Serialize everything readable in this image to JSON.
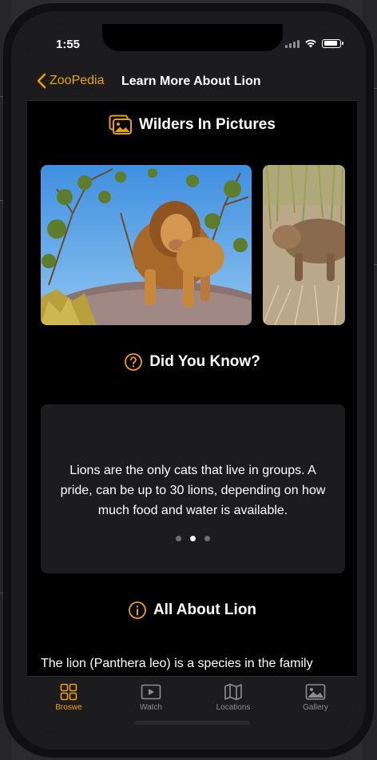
{
  "status_bar": {
    "time": "1:55",
    "battery_level_percent": 90
  },
  "nav": {
    "back_label": "ZooPedia",
    "title": "Learn More About Lion"
  },
  "gallery": {
    "heading": "Wilders In Pictures",
    "icon": "photos-icon",
    "photo_count_visible": 2
  },
  "did_you_know": {
    "heading": "Did You Know?",
    "icon": "question-circle-icon",
    "fact": "Lions are the only cats that live in groups. A pride, can be up to 30 lions, depending on how much food and water is available.",
    "page_count": 3,
    "current_page_index": 1
  },
  "about": {
    "heading": "All About Lion",
    "icon": "info-circle-icon",
    "text": "The lion (Panthera leo) is a species in the family"
  },
  "tabs": [
    {
      "label": "Broswe",
      "icon": "grid-icon",
      "active": true
    },
    {
      "label": "Watch",
      "icon": "play-rectangle-icon",
      "active": false
    },
    {
      "label": "Locations",
      "icon": "map-icon",
      "active": false
    },
    {
      "label": "Gallery",
      "icon": "photo-icon",
      "active": false
    }
  ],
  "colors": {
    "accent": "#f0a000",
    "background": "#000000",
    "card": "#1c1c1e",
    "inactive_tab": "#8e8e93"
  }
}
